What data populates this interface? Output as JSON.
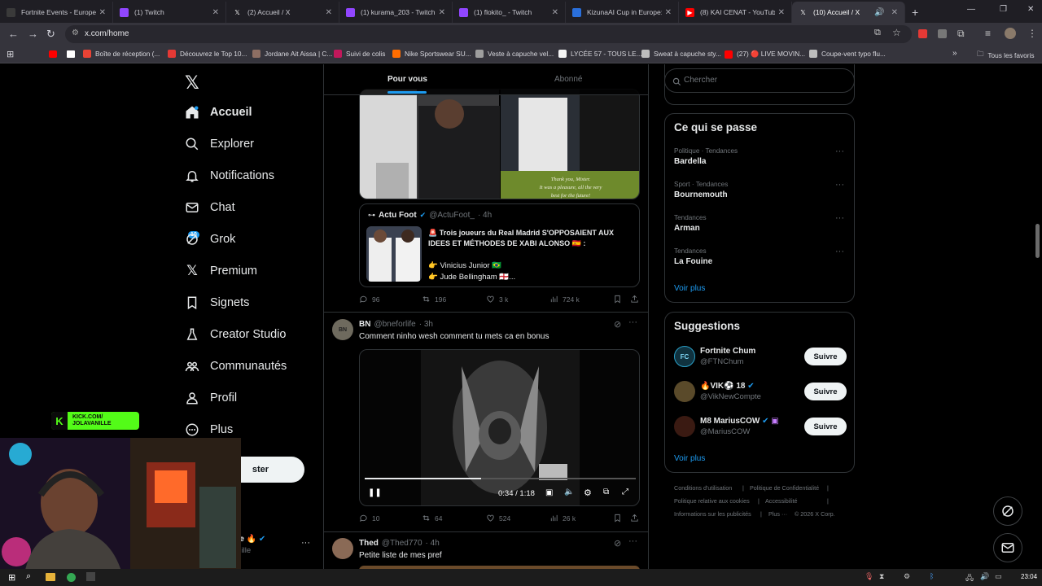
{
  "browser": {
    "tabs": [
      {
        "title": "Fortnite Events - Europe",
        "color": "#3a3a3a"
      },
      {
        "title": "(1) Twitch",
        "color": "#9146ff"
      },
      {
        "title": "(2) Accueil / X",
        "color": "#000000"
      },
      {
        "title": "(1) kurama_203 - Twitch",
        "color": "#9146ff"
      },
      {
        "title": "(1) flokito_ - Twitch",
        "color": "#9146ff"
      },
      {
        "title": "KizunaAI Cup in Europe: S",
        "color": "#2a6fdb"
      },
      {
        "title": "(8) KAI CENAT - YouTube",
        "color": "#ff0000"
      },
      {
        "title": "(10) Accueil / X",
        "color": "#000000"
      }
    ],
    "new_tab": "+",
    "url": "x.com/home",
    "bookmarks": [
      {
        "label": "Boîte de réception (...",
        "color": "#ea4335"
      },
      {
        "label": "Découvrez le Top 10...",
        "color": "#e53935"
      },
      {
        "label": "Jordane Ait Aissa | C...",
        "color": "#8d6e63"
      },
      {
        "label": "Suivi de colis",
        "color": "#c2185b"
      },
      {
        "label": "Nike Sportswear SU...",
        "color": "#ff6d00"
      },
      {
        "label": "Veste à capuche vel...",
        "color": "#9e9e9e"
      },
      {
        "label": "LYCÉE 57 - TOUS LE...",
        "color": "#f5f5f5"
      },
      {
        "label": "Sweat à capuche sty...",
        "color": "#bdbdbd"
      },
      {
        "label": "(27) 🔴 LIVE MOVIN...",
        "color": "#ff0000"
      },
      {
        "label": "Coupe-vent typo flu...",
        "color": "#bdbdbd"
      }
    ],
    "all_bookmarks": "Tous les favoris"
  },
  "nav": {
    "items": [
      {
        "label": "Accueil",
        "icon": "home-icon"
      },
      {
        "label": "Explorer",
        "icon": "search-icon"
      },
      {
        "label": "Notifications",
        "icon": "bell-icon"
      },
      {
        "label": "Chat",
        "icon": "mail-icon"
      },
      {
        "label": "Grok",
        "icon": "grok-icon"
      },
      {
        "label": "Premium",
        "icon": "x-icon"
      },
      {
        "label": "Signets",
        "icon": "bookmark-icon"
      },
      {
        "label": "Creator Studio",
        "icon": "flask-icon"
      },
      {
        "label": "Communautés",
        "icon": "people-icon"
      },
      {
        "label": "Profil",
        "icon": "person-icon"
      },
      {
        "label": "Plus",
        "icon": "more-icon"
      }
    ],
    "notif_count": "10",
    "post_button_partial": "ster",
    "profile_name_partial": "ille",
    "profile_handle_partial": "anille"
  },
  "feed": {
    "tabs": [
      "Pour vous",
      "Abonné"
    ],
    "image_caption": "Thank you, Mister.\nIt was a pleasure, all the very\nbest for the future!",
    "quote": {
      "name": "Actu Foot",
      "handle": "@ActuFoot_",
      "time": "· 4h",
      "line1": "🚨 Trois joueurs du Real Madrid S'OPPOSAIENT AUX",
      "line2": "IDEES ET MÉTHODES DE XABI ALONSO 🇪🇸 :",
      "line3": "👉 Vinicius Junior 🇧🇷",
      "line4": "👉 Jude Bellingham 🏴󠁧󠁢󠁥󠁮󠁧󠁿..."
    },
    "post1_stats": {
      "replies": "96",
      "reposts": "196",
      "likes": "3 k",
      "views": "724 k"
    },
    "post2": {
      "avatar_text": "BN",
      "name": "BN",
      "handle": "@bneforlife",
      "time": "· 3h",
      "text": "Comment ninho wesh comment tu mets ca en bonus",
      "video_time": "0:34 / 1:18",
      "progress": 0.43,
      "stats": {
        "replies": "10",
        "reposts": "64",
        "likes": "524",
        "views": "26 k"
      }
    },
    "post3": {
      "name": "Thed",
      "handle": "@Thed770",
      "time": "· 4h",
      "text": "Petite liste de mes pref"
    }
  },
  "right": {
    "search_placeholder": "Chercher",
    "trending_title": "Ce qui se passe",
    "trends": [
      {
        "meta": "Politique · Tendances",
        "name": "Bardella"
      },
      {
        "meta": "Sport · Tendances",
        "name": "Bournemouth"
      },
      {
        "meta": "Tendances",
        "name": "Arman"
      },
      {
        "meta": "Tendances",
        "name": "La Fouine"
      }
    ],
    "see_more": "Voir plus",
    "suggestions_title": "Suggestions",
    "suggestions": [
      {
        "name": "Fortnite Chum",
        "handle": "@FTNChum",
        "avatar": "FC"
      },
      {
        "name": "🔥VIK⚽ 18",
        "handle": "@VikNewCompte",
        "avatar": ""
      },
      {
        "name": "M8 MariusCOW",
        "handle": "@MariusCOW",
        "avatar": ""
      }
    ],
    "follow_label": "Suivre",
    "footer": [
      "Conditions d'utilisation",
      "|",
      "Politique de Confidentialité",
      "|",
      "Politique relative aux cookies",
      "|",
      "Accessibilité",
      "|",
      "Informations sur les publicités",
      "|",
      "Plus ···",
      "© 2026 X Corp."
    ]
  },
  "overlay": {
    "kick_line1": "KICK.COM/",
    "kick_line2": "JOLAVANILLE"
  },
  "taskbar": {
    "clock": "23:04"
  },
  "colors": {
    "accent": "#1d9bf0",
    "kick": "#53fc18"
  }
}
